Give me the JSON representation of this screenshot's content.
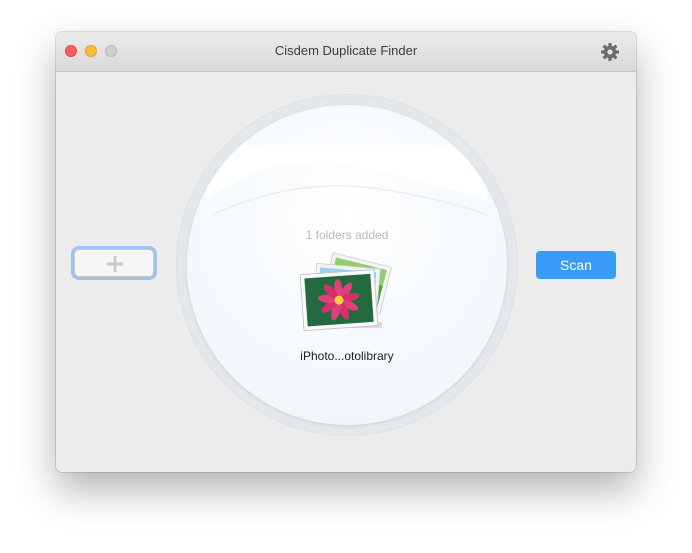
{
  "window": {
    "title": "Cisdem Duplicate Finder"
  },
  "titlebar": {
    "buttons": [
      "close",
      "minimize",
      "zoom"
    ],
    "settings_icon": "gear-icon"
  },
  "main": {
    "add_icon": "plus-icon",
    "folders_status": "1 folders added",
    "item": {
      "name": "iPhoto...otolibrary",
      "icon": "photos-library-icon"
    },
    "scan_label": "Scan"
  },
  "colors": {
    "accent": "#3a9bf7",
    "close": "#fc605b",
    "minimize": "#fdbc40"
  }
}
